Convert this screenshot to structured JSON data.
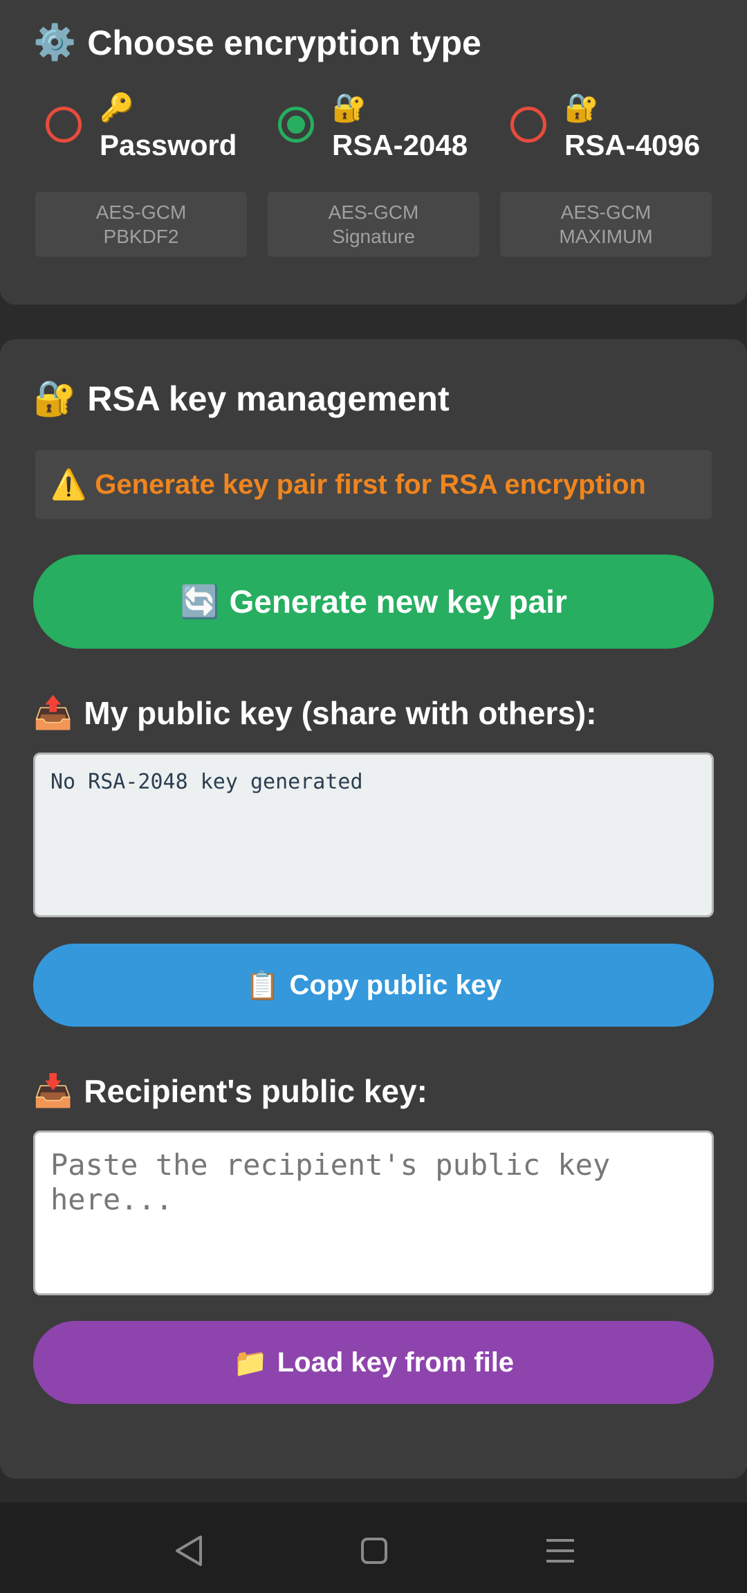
{
  "encryption": {
    "title_icon": "⚙️",
    "title": "Choose encryption type",
    "options": [
      {
        "icon": "🔑",
        "label": "Password",
        "selected": false,
        "sub1": "AES-GCM",
        "sub2": "PBKDF2"
      },
      {
        "icon": "🔐",
        "label": "RSA-2048",
        "selected": true,
        "sub1": "AES-GCM",
        "sub2": "Signature"
      },
      {
        "icon": "🔐",
        "label": "RSA-4096",
        "selected": false,
        "sub1": "AES-GCM",
        "sub2": "MAXIMUM"
      }
    ]
  },
  "rsa": {
    "title_icon": "🔐",
    "title": "RSA key management",
    "warning_icon": "⚠️",
    "warning": "Generate key pair first for RSA encryption",
    "generate_icon": "🔄",
    "generate_label": "Generate new key pair",
    "public_key_icon": "📤",
    "public_key_title": "My public key (share with others):",
    "public_key_value": "No RSA-2048 key generated",
    "copy_icon": "📋",
    "copy_label": "Copy public key",
    "recipient_icon": "📥",
    "recipient_title": "Recipient's public key:",
    "recipient_placeholder": "Paste the recipient's public key here...",
    "load_icon": "📁",
    "load_label": "Load key from file"
  },
  "nav": {
    "back_icon": "back-triangle-icon",
    "home_icon": "home-square-icon",
    "menu_icon": "menu-lines-icon"
  },
  "colors": {
    "green": "#27ae60",
    "blue": "#3498db",
    "purple": "#8e44ad",
    "warning": "#f0851e",
    "radio_unselected": "#e74c3c"
  }
}
